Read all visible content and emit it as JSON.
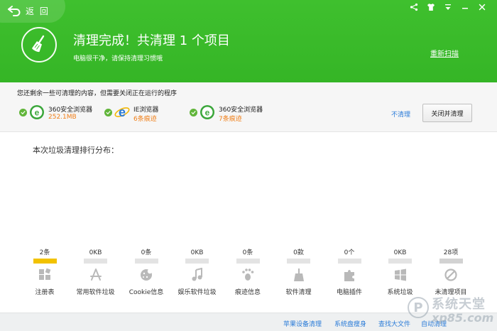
{
  "header": {
    "back_label": "返 回",
    "title": "清理完成！共清理  1  个项目",
    "subtitle": "电脑很干净，请保持清理习惯哦",
    "rescan_label": "重新扫描",
    "window_controls": [
      "share-icon",
      "shirt-icon",
      "menu-icon",
      "minimize-icon",
      "close-icon"
    ]
  },
  "notice": {
    "text": "您还剩余一些可清理的内容，但需要关闭正在运行的程序",
    "browsers": [
      {
        "name": "360安全浏览器",
        "value": "252.1MB",
        "icon": "360-browser-icon"
      },
      {
        "name": "IE浏览器",
        "value": "6条痕迹",
        "icon": "ie-browser-icon"
      },
      {
        "name": "360安全浏览器",
        "value": "7条痕迹",
        "icon": "360-browser-icon"
      }
    ],
    "no_clean_label": "不清理",
    "close_clean_label": "关闭并清理"
  },
  "ranking": {
    "title": "本次垃圾清理排行分布：",
    "categories": [
      {
        "count": "2条",
        "label": "注册表",
        "icon": "registry-icon",
        "fill": 1.0,
        "color": "#f2c200"
      },
      {
        "count": "0KB",
        "label": "常用软件垃圾",
        "icon": "app-store-icon",
        "fill": 0.0,
        "color": "#d2d2d2"
      },
      {
        "count": "0条",
        "label": "Cookie信息",
        "icon": "cookie-icon",
        "fill": 0.0,
        "color": "#d2d2d2"
      },
      {
        "count": "0KB",
        "label": "娱乐软件垃圾",
        "icon": "music-icon",
        "fill": 0.0,
        "color": "#d2d2d2"
      },
      {
        "count": "0条",
        "label": "痕迹信息",
        "icon": "footprint-icon",
        "fill": 0.0,
        "color": "#d2d2d2"
      },
      {
        "count": "0款",
        "label": "软件清理",
        "icon": "broom-icon",
        "fill": 0.0,
        "color": "#d2d2d2"
      },
      {
        "count": "0个",
        "label": "电脑插件",
        "icon": "puzzle-icon",
        "fill": 0.0,
        "color": "#d2d2d2"
      },
      {
        "count": "0KB",
        "label": "系统垃圾",
        "icon": "windows-icon",
        "fill": 0.0,
        "color": "#d2d2d2"
      },
      {
        "count": "28项",
        "label": "未清理项目",
        "icon": "forbidden-icon",
        "fill": 1.0,
        "color": "#d2d2d2"
      }
    ]
  },
  "footer": {
    "links": [
      "苹果设备清理",
      "系统盘瘦身",
      "查找大文件",
      "自动清理"
    ]
  },
  "watermark": {
    "line1": "系统天堂",
    "line2": "xp85.com"
  },
  "colors": {
    "header_green": "#3cbd2c",
    "link_blue": "#2a7bd8",
    "orange": "#f07e17",
    "check_green": "#61b53a"
  }
}
